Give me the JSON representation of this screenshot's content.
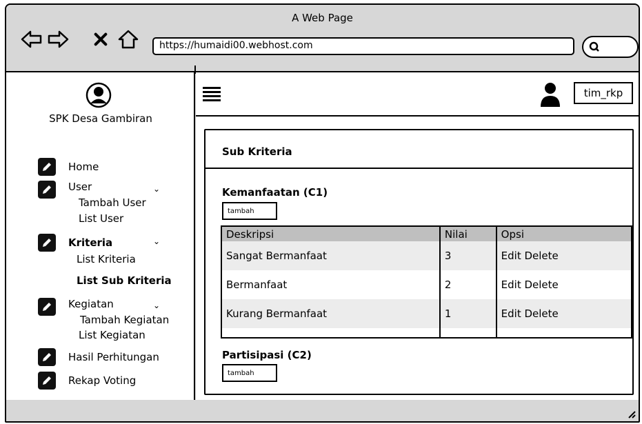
{
  "window": {
    "title": "A Web Page"
  },
  "browser": {
    "url": "https://humaidi00.webhost.com",
    "nav_icons": [
      "back-arrow-icon",
      "forward-arrow-icon",
      "close-x-icon",
      "home-icon"
    ],
    "search_icon": "search-icon"
  },
  "sidebar": {
    "brand": "SPK Desa Gambiran",
    "menu": [
      {
        "label": "Home"
      },
      {
        "label": "User",
        "sub": [
          "Tambah User",
          "List User"
        ]
      },
      {
        "label": "Kriteria",
        "sub": [
          "List Kriteria",
          "List Sub Kriteria"
        ]
      },
      {
        "label": "Kegiatan",
        "sub": [
          "Tambah Kegiatan",
          "List Kegiatan"
        ]
      },
      {
        "label": "Hasil Perhitungan"
      },
      {
        "label": "Rekap Voting"
      }
    ]
  },
  "header": {
    "username": "tim_rkp"
  },
  "card": {
    "title": "Sub Kriteria",
    "sections": [
      {
        "title": "Kemanfaatan (C1)",
        "add_label": "tambah",
        "columns": [
          "Deskripsi",
          "Nilai",
          "Opsi"
        ],
        "rows": [
          {
            "deskripsi": "Sangat Bermanfaat",
            "nilai": "3",
            "opsi": "Edit Delete"
          },
          {
            "deskripsi": "Bermanfaat",
            "nilai": "2",
            "opsi": "Edit Delete"
          },
          {
            "deskripsi": "Kurang Bermanfaat",
            "nilai": "1",
            "opsi": "Edit Delete"
          }
        ]
      },
      {
        "title": "Partisipasi (C2)",
        "add_label": "tambah"
      }
    ]
  },
  "colors": {
    "chrome": "#d7d7d7",
    "table_header": "#bfbfbf",
    "row_alt": "#ececec"
  }
}
